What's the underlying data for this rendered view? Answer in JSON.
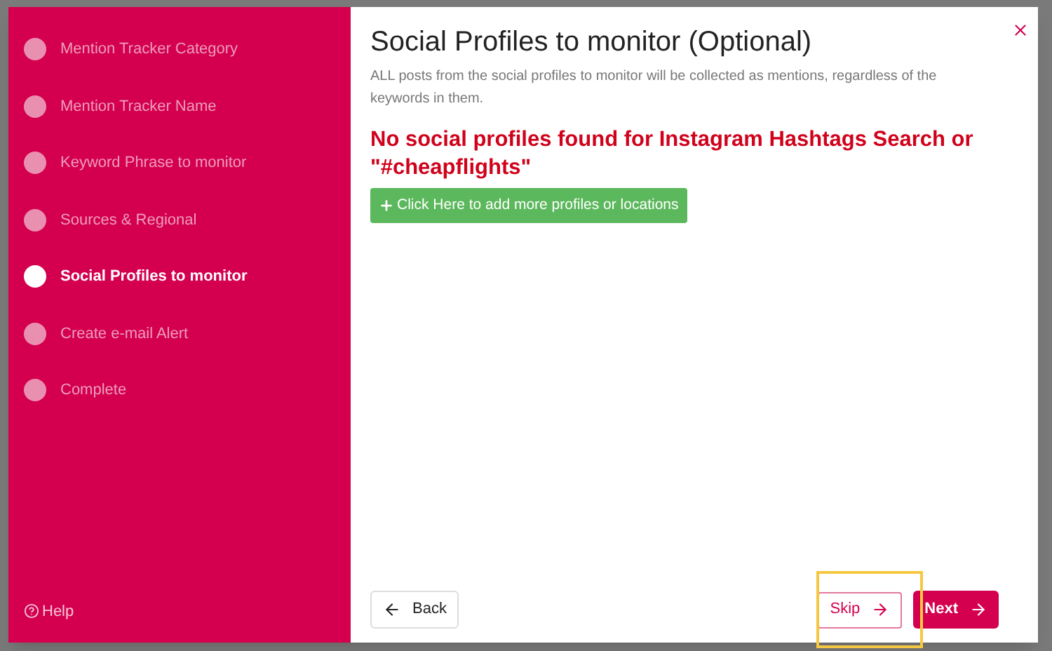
{
  "steps": [
    {
      "label": "Mention Tracker Category",
      "selected": false
    },
    {
      "label": "Mention Tracker Name",
      "selected": false
    },
    {
      "label": "Keyword Phrase to monitor",
      "selected": false
    },
    {
      "label": "Sources & Regional",
      "selected": false
    },
    {
      "label": "Social Profiles to monitor",
      "selected": true
    },
    {
      "label": "Create e-mail Alert",
      "selected": false
    },
    {
      "label": "Complete",
      "selected": false
    }
  ],
  "help": "Help",
  "title": "Social Profiles to monitor (Optional)",
  "description": "ALL posts from the social profiles to monitor will be collected as mentions, regardless of the keywords in them.",
  "warning": "No social profiles found for Instagram Hashtags Search or \"#cheapflights\"",
  "add_button": "Click Here to add more profiles or locations",
  "back_button": "Back",
  "skip_button": "Skip",
  "next_button": "Next"
}
